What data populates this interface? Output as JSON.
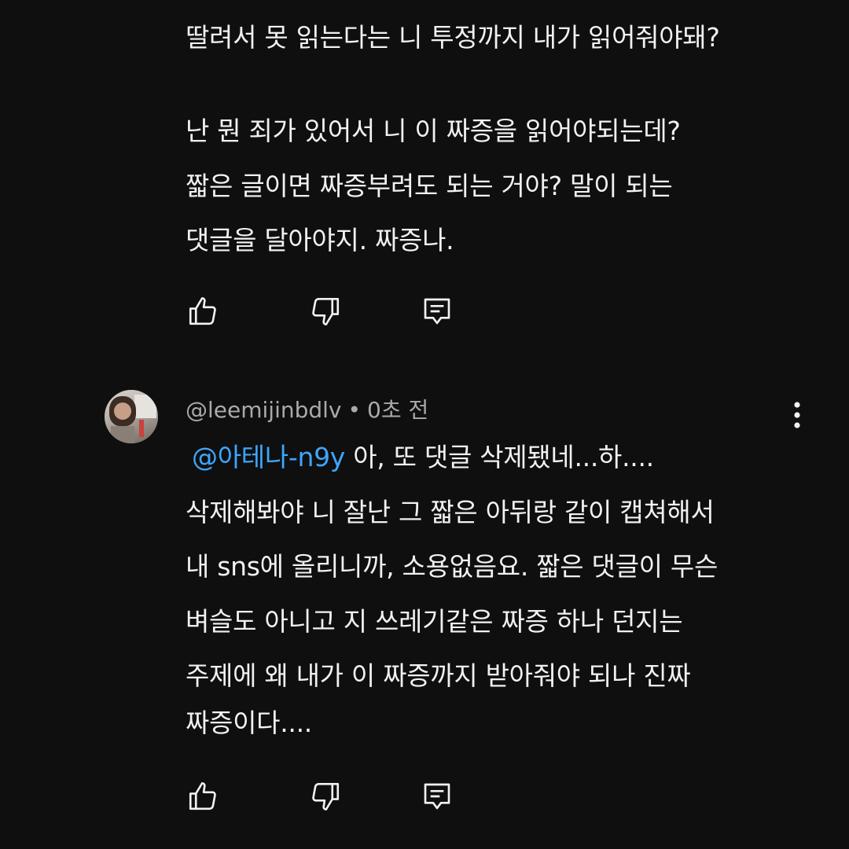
{
  "comment_1": {
    "lines": [
      "딸려서 못 읽는다는 니 투정까지 내가 읽어줘야돼?",
      "난 뭔 죄가 있어서 니 이 짜증을 읽어야되는데?",
      "짧은 글이면 짜증부려도 되는 거야? 말이 되는",
      "댓글을 달아야지. 짜증나."
    ],
    "actions": [
      "like-icon",
      "dislike-icon",
      "reply-icon"
    ]
  },
  "comment_2": {
    "author": "@leemijinbdlv",
    "separator": "•",
    "time": "0초 전",
    "mention": "@아테나-n9y",
    "first_line_rest": " 아, 또 댓글 삭제됐네...하....",
    "lines": [
      "삭제해봐야 니 잘난 그 짧은 아뒤랑 같이 캡쳐해서",
      "내 sns에 올리니까, 소용없음요. 짧은 댓글이 무슨",
      "벼슬도 아니고 지 쓰레기같은 짜증 하나 던지는",
      "주제에 왜 내가 이 짜증까지 받아줘야 되나 진짜",
      "짜증이다...."
    ],
    "actions": [
      "like-icon",
      "dislike-icon",
      "reply-icon",
      "more-vert-icon"
    ]
  },
  "colors": {
    "background": "#0f0f0f",
    "text": "#f1f1f1",
    "secondary_text": "#aaaaaa",
    "mention": "#3ea6ff"
  }
}
